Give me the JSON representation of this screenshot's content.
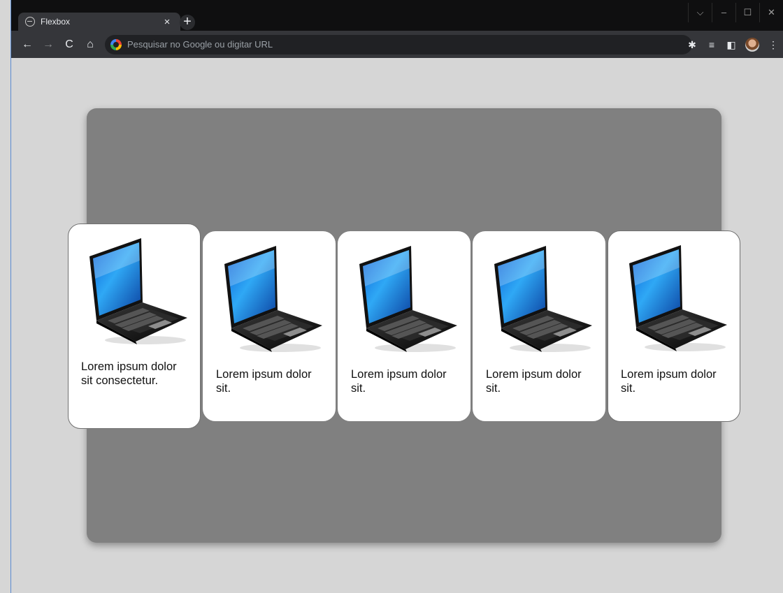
{
  "browser": {
    "tab_title": "Flexbox",
    "tab_close": "×",
    "new_tab": "+",
    "address_placeholder": "Pesquisar no Google ou digitar URL",
    "window_controls": {
      "dropdown": "⌵",
      "minimize": "–",
      "maximize": "☐",
      "close": "✕"
    },
    "nav": {
      "back": "←",
      "forward": "→",
      "reload": "C",
      "home": "⌂"
    },
    "toolbar_icons": {
      "extensions": "✱",
      "reading_list": "≡",
      "side_panel": "◧",
      "menu": "⋮"
    }
  },
  "cards": [
    {
      "text": "Lorem ipsum dolor sit consectetur.",
      "image": "laptop-image"
    },
    {
      "text": "Lorem ipsum dolor sit.",
      "image": "laptop-image"
    },
    {
      "text": "Lorem ipsum dolor sit.",
      "image": "laptop-image"
    },
    {
      "text": "Lorem ipsum dolor sit.",
      "image": "laptop-image"
    },
    {
      "text": "Lorem ipsum dolor sit.",
      "image": "laptop-image"
    }
  ],
  "colors": {
    "page_background": "#d6d6d6",
    "container_background": "#808080",
    "card_background": "#ffffff",
    "chrome_dark": "#202124"
  }
}
